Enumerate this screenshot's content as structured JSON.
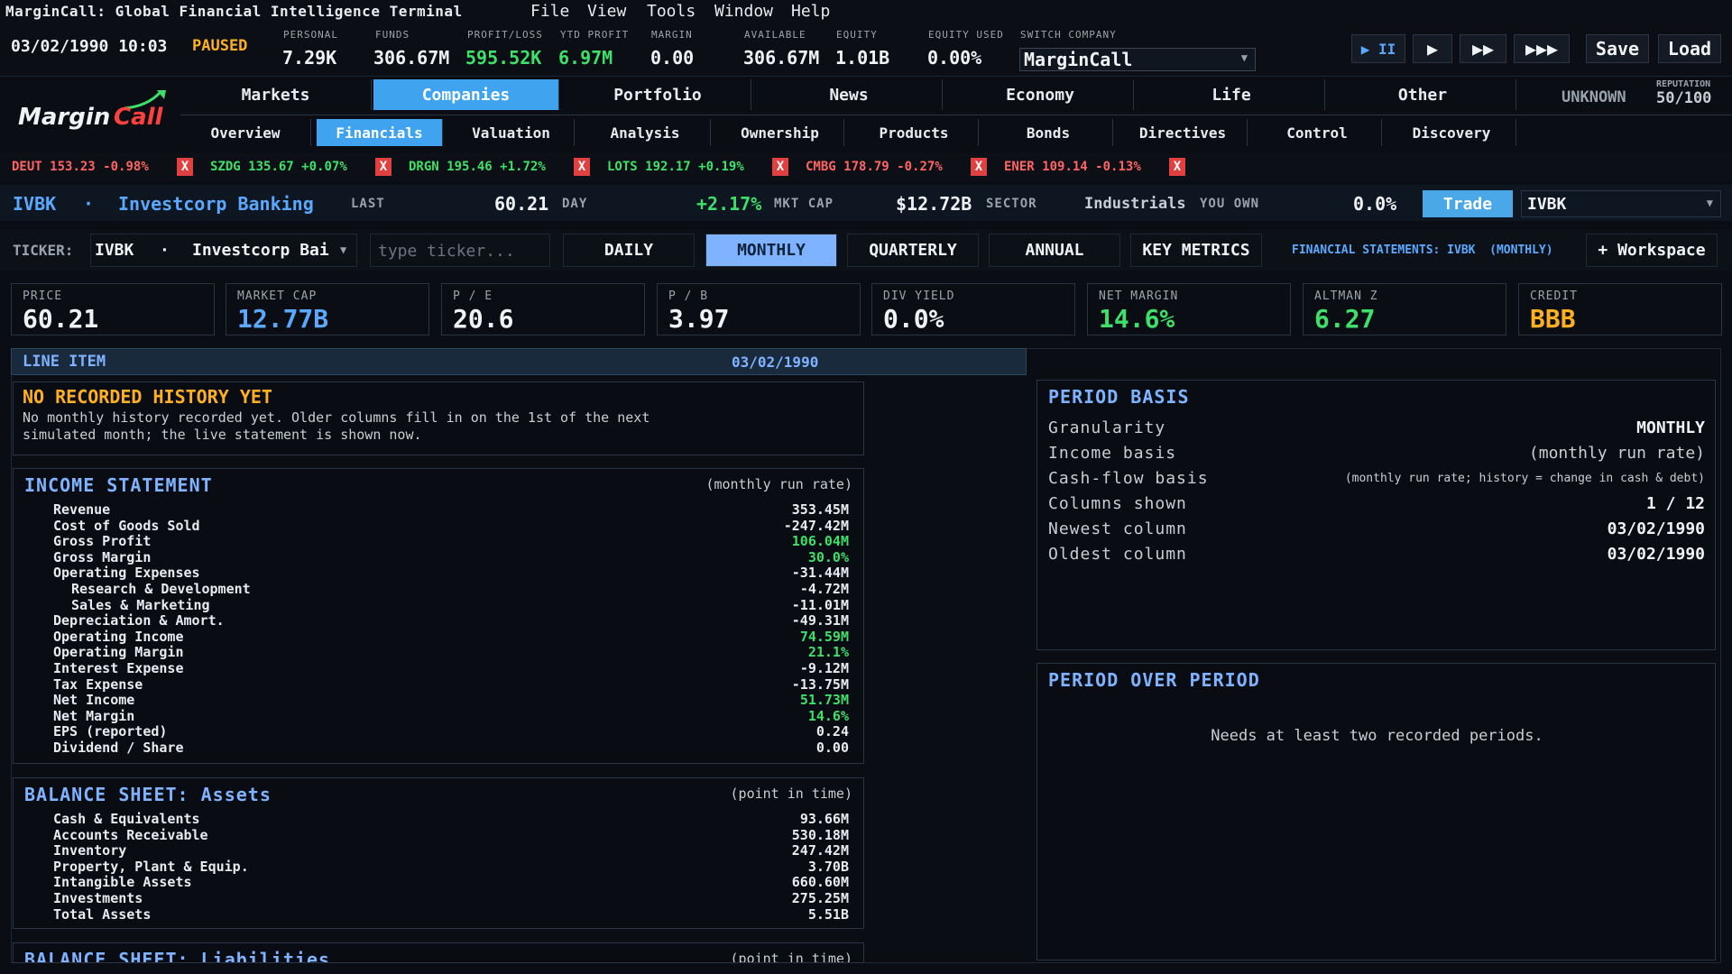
{
  "app": {
    "title": "MarginCall: Global Financial Intelligence Terminal"
  },
  "menu": [
    "File",
    "View",
    "Tools",
    "Window",
    "Help"
  ],
  "status": {
    "datetime": "03/02/1990 10:03",
    "state": "PAUSED",
    "stats": [
      {
        "label": "PERSONAL",
        "value": "7.29K"
      },
      {
        "label": "FUNDS",
        "value": "306.67M"
      },
      {
        "label": "PROFIT/LOSS",
        "value": "595.52K"
      },
      {
        "label": "YTD PROFIT",
        "value": "6.97M"
      },
      {
        "label": "MARGIN",
        "value": "0.00"
      },
      {
        "label": "AVAILABLE",
        "value": "306.67M"
      },
      {
        "label": "EQUITY",
        "value": "1.01B"
      },
      {
        "label": "EQUITY USED",
        "value": "0.00%"
      }
    ],
    "switch_company_label": "SWITCH COMPANY",
    "switch_company_value": "MarginCall",
    "controls": [
      "▶ II",
      "▶",
      "▶▶",
      "▶▶▶"
    ],
    "save": "Save",
    "load": "Load"
  },
  "logo": {
    "text1": "Margin",
    "text2": "Call"
  },
  "main_tabs": [
    "Markets",
    "Companies",
    "Portfolio",
    "News",
    "Economy",
    "Life",
    "Other"
  ],
  "reputation": {
    "status": "UNKNOWN",
    "label": "REPUTATION",
    "value": "50/100"
  },
  "sub_tabs": [
    "Overview",
    "Financials",
    "Valuation",
    "Analysis",
    "Ownership",
    "Products",
    "Bonds",
    "Directives",
    "Control",
    "Discovery"
  ],
  "tape": [
    {
      "sym": "DEUT",
      "price": "153.23",
      "chg": "-0.98%",
      "dir": "down"
    },
    {
      "sym": "SZDG",
      "price": "135.67",
      "chg": "+0.07%",
      "dir": "up"
    },
    {
      "sym": "DRGN",
      "price": "195.46",
      "chg": "+1.72%",
      "dir": "up"
    },
    {
      "sym": "LOTS",
      "price": "192.17",
      "chg": "+0.19%",
      "dir": "up"
    },
    {
      "sym": "CMBG",
      "price": "178.79",
      "chg": "-0.27%",
      "dir": "down"
    },
    {
      "sym": "ENER",
      "price": "109.14",
      "chg": "-0.13%",
      "dir": "down"
    }
  ],
  "tape_close": "X",
  "company": {
    "ticker": "IVBK",
    "sep": "·",
    "name": "Investcorp Banking",
    "last_label": "LAST",
    "last": "60.21",
    "day_label": "DAY",
    "day": "+2.17%",
    "mktcap_label": "MKT CAP",
    "mktcap": "$12.72B",
    "sector_label": "SECTOR",
    "sector": "Industrials",
    "own_label": "YOU OWN",
    "own": "0.0%",
    "trade": "Trade",
    "dropdown": "IVBK"
  },
  "statement_controls": {
    "ticker_label": "TICKER:",
    "ticker": "IVBK",
    "ticker_sep": "·",
    "ticker_name": "Investcorp Bai",
    "search_placeholder": "type ticker...",
    "periods": [
      "DAILY",
      "MONTHLY",
      "QUARTERLY",
      "ANNUAL",
      "KEY METRICS"
    ],
    "caption": "FINANCIAL STATEMENTS: IVBK  (MONTHLY)",
    "workspace": "+ Workspace"
  },
  "metrics": [
    {
      "label": "PRICE",
      "value": "60.21",
      "color": "#f0f3f6"
    },
    {
      "label": "MARKET CAP",
      "value": "12.77B",
      "color": "#5aa9ff"
    },
    {
      "label": "P / E",
      "value": "20.6",
      "color": "#f0f3f6"
    },
    {
      "label": "P / B",
      "value": "3.97",
      "color": "#f0f3f6"
    },
    {
      "label": "DIV YIELD",
      "value": "0.0%",
      "color": "#f0f3f6"
    },
    {
      "label": "NET MARGIN",
      "value": "14.6%",
      "color": "#3fe06a"
    },
    {
      "label": "ALTMAN Z",
      "value": "6.27",
      "color": "#3fe06a"
    },
    {
      "label": "CREDIT",
      "value": "BBB",
      "color": "#ffb020"
    }
  ],
  "line_item_header": {
    "label": "LINE ITEM",
    "date": "03/02/1990"
  },
  "notice": {
    "title": "NO RECORDED HISTORY YET",
    "line1": "No monthly history recorded yet. Older columns fill in on the 1st of the next",
    "line2": "simulated month; the live statement is shown now."
  },
  "income": {
    "title": "INCOME STATEMENT",
    "sub": "(monthly run rate)",
    "rows": [
      {
        "label": "Revenue",
        "value": "353.45M",
        "indent": 0,
        "green": false
      },
      {
        "label": "Cost of Goods Sold",
        "value": "-247.42M",
        "indent": 0,
        "green": false
      },
      {
        "label": "Gross Profit",
        "value": "106.04M",
        "indent": 0,
        "green": true
      },
      {
        "label": "Gross Margin",
        "value": "30.0%",
        "indent": 0,
        "green": true
      },
      {
        "label": "Operating Expenses",
        "value": "-31.44M",
        "indent": 0,
        "green": false
      },
      {
        "label": "Research & Development",
        "value": "-4.72M",
        "indent": 1,
        "green": false
      },
      {
        "label": "Sales & Marketing",
        "value": "-11.01M",
        "indent": 1,
        "green": false
      },
      {
        "label": "Depreciation & Amort.",
        "value": "-49.31M",
        "indent": 0,
        "green": false
      },
      {
        "label": "Operating Income",
        "value": "74.59M",
        "indent": 0,
        "green": true
      },
      {
        "label": "Operating Margin",
        "value": "21.1%",
        "indent": 0,
        "green": true
      },
      {
        "label": "Interest Expense",
        "value": "-9.12M",
        "indent": 0,
        "green": false
      },
      {
        "label": "Tax Expense",
        "value": "-13.75M",
        "indent": 0,
        "green": false
      },
      {
        "label": "Net Income",
        "value": "51.73M",
        "indent": 0,
        "green": true
      },
      {
        "label": "Net Margin",
        "value": "14.6%",
        "indent": 0,
        "green": true
      },
      {
        "label": "EPS (reported)",
        "value": "0.24",
        "indent": 0,
        "green": false
      },
      {
        "label": "Dividend / Share",
        "value": "0.00",
        "indent": 0,
        "green": false
      }
    ]
  },
  "assets": {
    "title": "BALANCE SHEET: Assets",
    "sub": "(point in time)",
    "rows": [
      {
        "label": "Cash & Equivalents",
        "value": "93.66M"
      },
      {
        "label": "Accounts Receivable",
        "value": "530.18M"
      },
      {
        "label": "Inventory",
        "value": "247.42M"
      },
      {
        "label": "Property, Plant & Equip.",
        "value": "3.70B"
      },
      {
        "label": "Intangible Assets",
        "value": "660.60M"
      },
      {
        "label": "Investments",
        "value": "275.25M"
      },
      {
        "label": "Total Assets",
        "value": "5.51B"
      }
    ]
  },
  "liabilities": {
    "title": "BALANCE SHEET: Liabilities",
    "sub": "(point in time)"
  },
  "period_basis": {
    "title": "PERIOD BASIS",
    "rows": [
      {
        "label": "Granularity",
        "value": "MONTHLY"
      },
      {
        "label": "Income basis",
        "value": "(monthly run rate)"
      },
      {
        "label": "Cash-flow basis",
        "value": "(monthly run rate; history = change in cash & debt)"
      },
      {
        "label": "Columns shown",
        "value": "1 / 12"
      },
      {
        "label": "Newest column",
        "value": "03/02/1990"
      },
      {
        "label": "Oldest column",
        "value": "03/02/1990"
      }
    ]
  },
  "period_over_period": {
    "title": "PERIOD OVER PERIOD",
    "message": "Needs at least two recorded periods."
  }
}
